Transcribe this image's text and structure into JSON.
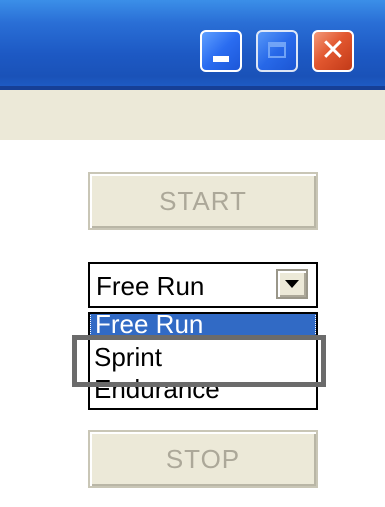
{
  "titlebar": {
    "buttons": {
      "minimize_icon": "minimize-icon",
      "maximize_icon": "maximize-icon",
      "close_icon": "close-icon",
      "close_glyph": "✕"
    }
  },
  "controls": {
    "start_label": "START",
    "stop_label": "STOP",
    "mode_select": {
      "selected_value": "Free Run",
      "options": [
        "Free Run",
        "Sprint",
        "Endurance"
      ],
      "highlighted_index": 0,
      "outlined_option": "Sprint"
    }
  },
  "colors": {
    "titlebar_blue": "#1d59c4",
    "selection_blue": "#316ac5",
    "disabled_text": "#aca899",
    "button_face": "#ece9d8",
    "close_red": "#e2572f",
    "outline_gray": "#6b6b6b"
  }
}
